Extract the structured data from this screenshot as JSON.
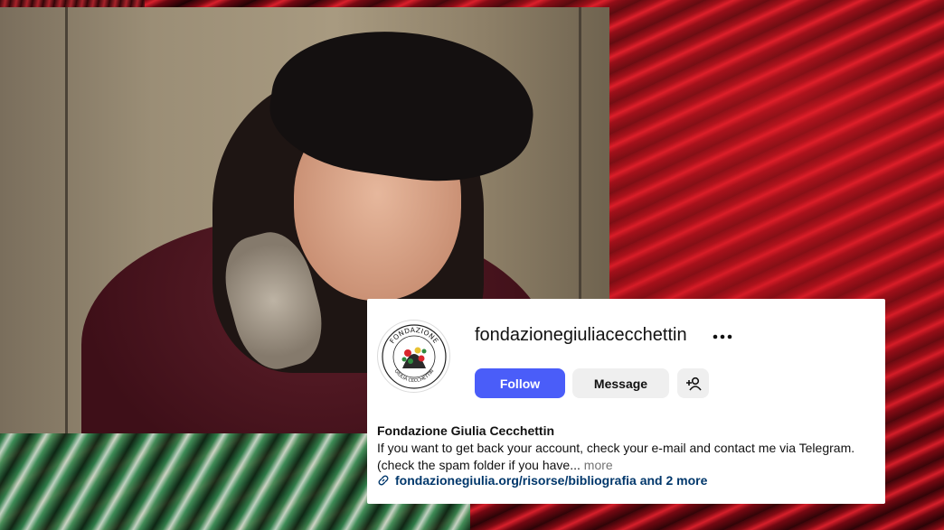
{
  "profile": {
    "username": "fondazionegiuliacecchettin",
    "follow_label": "Follow",
    "message_label": "Message",
    "display_name": "Fondazione Giulia Cecchettin",
    "bio_text": "If you want to get back your account, check your e-mail and contact me via Telegram. (check the spam folder if you have...",
    "bio_more": "more",
    "link_text": "fondazionegiulia.org/risorse/bibliografia and 2 more",
    "avatar_text_top": "FONDAZIONE",
    "avatar_text_bottom": "GIULIA CECCHETTIN"
  },
  "icons": {
    "more": "more-horizontal-icon",
    "add_user": "add-user-icon",
    "link": "link-icon"
  },
  "colors": {
    "follow_button": "#4a5df9",
    "secondary_button": "#efefef",
    "link": "#00376b"
  }
}
